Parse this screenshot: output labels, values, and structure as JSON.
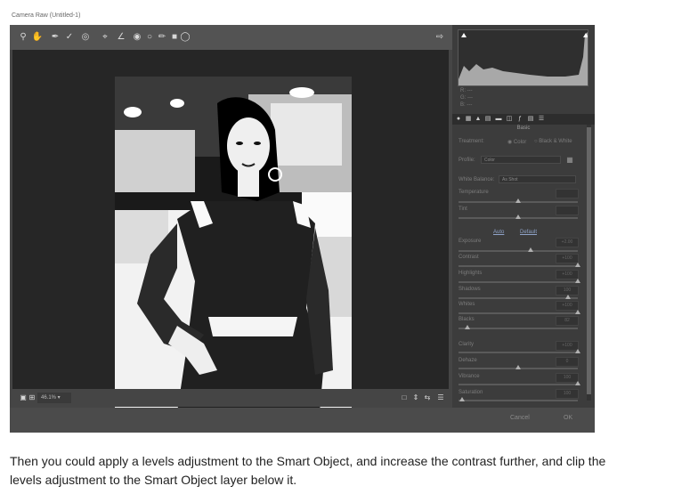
{
  "window_title": "Camera Raw (Untitled-1)",
  "toolbar": {
    "tools": [
      "zoom-icon",
      "hand-icon",
      "white-balance-icon",
      "color-sampler-icon",
      "target-adjust-icon",
      "crop-icon",
      "straighten-icon",
      "spot-removal-icon",
      "red-eye-icon",
      "adjustment-brush-icon",
      "graduated-filter-icon",
      "radial-filter-icon"
    ],
    "open_preferences_icon": "open-image-icon"
  },
  "photo": {
    "watermark": "Ac"
  },
  "status": {
    "zoom": "46.1%"
  },
  "rgb_readout": {
    "r": "R:  ---",
    "g": "G:  ---",
    "b": "B:  ---"
  },
  "panel": {
    "section_title": "Basic",
    "treatment_label": "Treatment:",
    "treatment_color": "Color",
    "treatment_bw": "Black & White",
    "profile_label": "Profile:",
    "profile_value": "Color",
    "white_balance_label": "White Balance:",
    "white_balance_value": "As Shot",
    "temperature_label": "Temperature",
    "tint_label": "Tint",
    "auto_link": "Auto",
    "default_link": "Default",
    "exposure_label": "Exposure",
    "exposure_value": "+2.00",
    "contrast_label": "Contrast",
    "contrast_value": "+100",
    "highlights_label": "Highlights",
    "highlights_value": "+100",
    "shadows_label": "Shadows",
    "shadows_value": "100",
    "whites_label": "Whites",
    "whites_value": "+100",
    "blacks_label": "Blacks",
    "blacks_value": "82",
    "clarity_label": "Clarity",
    "clarity_value": "+100",
    "dehaze_label": "Dehaze",
    "dehaze_value": "0",
    "vibrance_label": "Vibrance",
    "vibrance_value": "100",
    "saturation_label": "Saturation",
    "saturation_value": "100"
  },
  "footer": {
    "cancel": "Cancel",
    "ok": "OK"
  },
  "description": "Then you could apply a levels adjustment to the Smart Object, and increase the contrast further, and clip the levels adjustment to the Smart Object layer below it."
}
